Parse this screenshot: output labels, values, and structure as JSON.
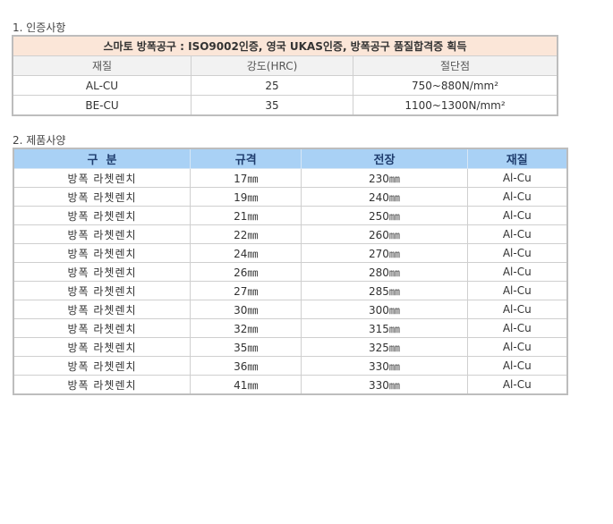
{
  "section1": {
    "title": "1. 인증사항",
    "banner": "스마토 방폭공구 : ISO9002인증, 영국 UKAS인증, 방폭공구 품질합격증 획득",
    "headers": [
      "재질",
      "강도(HRC)",
      "절단점"
    ],
    "rows": [
      [
        "AL-CU",
        "25",
        "750~880N/mm²"
      ],
      [
        "BE-CU",
        "35",
        "1100~1300N/mm²"
      ]
    ]
  },
  "section2": {
    "title": "2. 제품사양",
    "headers": [
      "구  분",
      "규격",
      "전장",
      "재질"
    ],
    "rows": [
      [
        "방폭 라쳇렌치",
        "17㎜",
        "230㎜",
        "Al-Cu"
      ],
      [
        "방폭 라쳇렌치",
        "19㎜",
        "240㎜",
        "Al-Cu"
      ],
      [
        "방폭 라쳇렌치",
        "21㎜",
        "250㎜",
        "Al-Cu"
      ],
      [
        "방폭 라쳇렌치",
        "22㎜",
        "260㎜",
        "Al-Cu"
      ],
      [
        "방폭 라쳇렌치",
        "24㎜",
        "270㎜",
        "Al-Cu"
      ],
      [
        "방폭 라쳇렌치",
        "26㎜",
        "280㎜",
        "Al-Cu"
      ],
      [
        "방폭 라쳇렌치",
        "27㎜",
        "285㎜",
        "Al-Cu"
      ],
      [
        "방폭 라쳇렌치",
        "30㎜",
        "300㎜",
        "Al-Cu"
      ],
      [
        "방폭 라쳇렌치",
        "32㎜",
        "315㎜",
        "Al-Cu"
      ],
      [
        "방폭 라쳇렌치",
        "35㎜",
        "325㎜",
        "Al-Cu"
      ],
      [
        "방폭 라쳇렌치",
        "36㎜",
        "330㎜",
        "Al-Cu"
      ],
      [
        "방폭 라쳇렌치",
        "41㎜",
        "330㎜",
        "Al-Cu"
      ]
    ]
  }
}
